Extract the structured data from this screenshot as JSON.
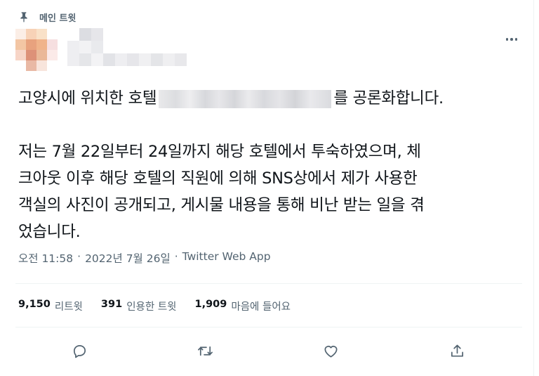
{
  "pinned": {
    "label": "메인 트윗",
    "icon": "pin-icon"
  },
  "tweet": {
    "line1_before": "고양시에 위치한 호텔",
    "line1_after": "를 공론화합니다.",
    "paragraph2_lines": [
      "저는 7월 22일부터 24일까지 해당 호텔에서 투숙하였으며, 체",
      "크아웃 이후 해당 호텔의 직원에 의해 SNS상에서 제가 사용한",
      "객실의 사진이 공개되고, 게시물 내용을 통해 비난 받는 일을 겪",
      "었습니다."
    ]
  },
  "meta": {
    "time": "오전 11:58",
    "sep1": "·",
    "date": "2022년 7월 26일",
    "sep2": "·",
    "source": "Twitter Web App"
  },
  "stats": {
    "retweets": {
      "num": "9,150",
      "label": "리트윗"
    },
    "quotes": {
      "num": "391",
      "label": "인용한 트윗"
    },
    "likes": {
      "num": "1,909",
      "label": "마음에 들어요"
    }
  },
  "actions": [
    "reply-icon",
    "retweet-icon",
    "like-icon",
    "share-icon"
  ],
  "colors": {
    "text": "#0f1419",
    "secondary": "#536471",
    "divider": "#eff3f4"
  }
}
